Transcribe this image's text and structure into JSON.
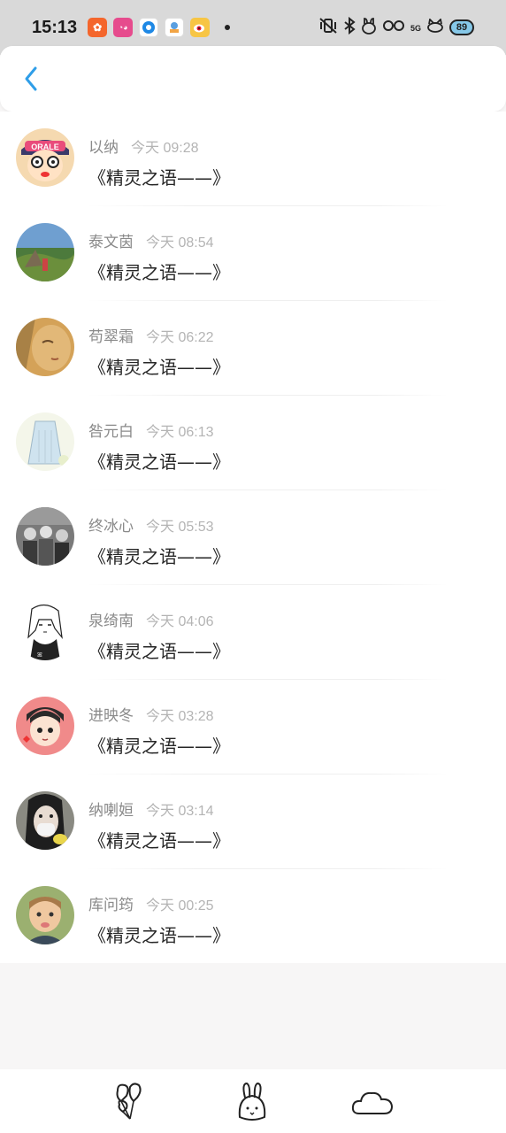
{
  "status_bar": {
    "time": "15:13",
    "network": "5G",
    "battery": "89",
    "apps": [
      "app-orange-icon",
      "app-pink-icon",
      "app-blue-circle-icon",
      "app-weather-icon",
      "weibo-icon"
    ]
  },
  "header": {
    "back_icon": "chevron-left-icon",
    "accent": "#2f9ee8"
  },
  "messages": [
    {
      "name": "以纳",
      "time": "今天 09:28",
      "text": "《精灵之语——》",
      "avatar": "avatar-cartoon-girl"
    },
    {
      "name": "泰文茵",
      "time": "今天 08:54",
      "text": "《精灵之语——》",
      "avatar": "avatar-landscape"
    },
    {
      "name": "苟翠霜",
      "time": "今天 06:22",
      "text": "《精灵之语——》",
      "avatar": "avatar-portrait-warm"
    },
    {
      "name": "咎元白",
      "time": "今天 06:13",
      "text": "《精灵之语——》",
      "avatar": "avatar-dress-sketch"
    },
    {
      "name": "终冰心",
      "time": "今天 05:53",
      "text": "《精灵之语——》",
      "avatar": "avatar-old-photo"
    },
    {
      "name": "泉绮南",
      "time": "今天 04:06",
      "text": "《精灵之语——》",
      "avatar": "avatar-lineart-girl"
    },
    {
      "name": "进映冬",
      "time": "今天 03:28",
      "text": "《精灵之语——》",
      "avatar": "avatar-chibi-boy"
    },
    {
      "name": "纳喇姮",
      "time": "今天 03:14",
      "text": "《精灵之语——》",
      "avatar": "avatar-girl-mask"
    },
    {
      "name": "库问筠",
      "time": "今天 00:25",
      "text": "《精灵之语——》",
      "avatar": "avatar-baby"
    }
  ],
  "bottom_nav": [
    "balloons-icon",
    "bunny-icon",
    "cloud-icon"
  ]
}
